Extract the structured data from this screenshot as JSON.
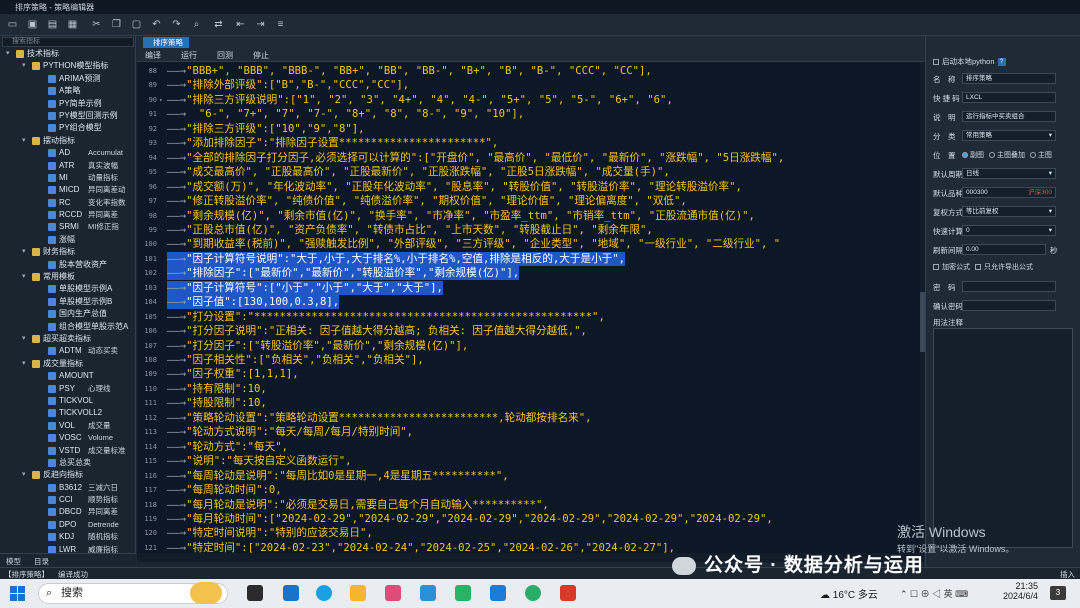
{
  "window": {
    "title": "排序策略 - 策略编辑器"
  },
  "toolbar": {
    "icons": [
      "new-file",
      "save",
      "save-as",
      "save-all",
      "cut",
      "copy",
      "paste",
      "undo",
      "redo",
      "find",
      "replace",
      "outdent",
      "indent",
      "comment"
    ]
  },
  "sidebar": {
    "search_placeholder": "搜索指标",
    "tree": [
      {
        "depth": 0,
        "kind": "folder",
        "label": "技术指标"
      },
      {
        "depth": 1,
        "kind": "folder",
        "label": "PYTHON模型指标"
      },
      {
        "depth": 2,
        "kind": "model",
        "label": "ARIMA预测"
      },
      {
        "depth": 2,
        "kind": "model",
        "label": "A策略"
      },
      {
        "depth": 2,
        "kind": "model",
        "label": "PY简单示例"
      },
      {
        "depth": 2,
        "kind": "model",
        "label": "PY模型回测示例"
      },
      {
        "depth": 2,
        "kind": "model",
        "label": "PY组合模型"
      },
      {
        "depth": 1,
        "kind": "folder",
        "label": "摆动指标"
      },
      {
        "depth": 2,
        "kind": "model",
        "label": "AD",
        "extra": "Accumulat"
      },
      {
        "depth": 2,
        "kind": "model",
        "label": "ATR",
        "extra": "真实波幅"
      },
      {
        "depth": 2,
        "kind": "model",
        "label": "MI",
        "extra": "动量指标"
      },
      {
        "depth": 2,
        "kind": "model",
        "label": "MICD",
        "extra": "异同离差动"
      },
      {
        "depth": 2,
        "kind": "model",
        "label": "RC",
        "extra": "变化率指数"
      },
      {
        "depth": 2,
        "kind": "model",
        "label": "RCCD",
        "extra": "异同离差"
      },
      {
        "depth": 2,
        "kind": "model",
        "label": "SRMI",
        "extra": "MI修正指"
      },
      {
        "depth": 2,
        "kind": "model",
        "label": "涨幅"
      },
      {
        "depth": 1,
        "kind": "folder",
        "label": "财务指标"
      },
      {
        "depth": 2,
        "kind": "model",
        "label": "股本营收资产"
      },
      {
        "depth": 1,
        "kind": "folder",
        "label": "常用模板"
      },
      {
        "depth": 2,
        "kind": "model",
        "label": "单股模型示例A"
      },
      {
        "depth": 2,
        "kind": "model",
        "label": "单股模型示例B"
      },
      {
        "depth": 2,
        "kind": "model",
        "label": "国内生产总值"
      },
      {
        "depth": 2,
        "kind": "model",
        "label": "组合模型单股示范A"
      },
      {
        "depth": 1,
        "kind": "folder",
        "label": "超买超卖指标"
      },
      {
        "depth": 2,
        "kind": "model",
        "label": "ADTM",
        "extra": "动态买卖"
      },
      {
        "depth": 1,
        "kind": "folder",
        "label": "成交量指标"
      },
      {
        "depth": 2,
        "kind": "model",
        "label": "AMOUNT"
      },
      {
        "depth": 2,
        "kind": "model",
        "label": "PSY",
        "extra": "心理线"
      },
      {
        "depth": 2,
        "kind": "model",
        "label": "TICKVOL"
      },
      {
        "depth": 2,
        "kind": "model",
        "label": "TICKVOLL2"
      },
      {
        "depth": 2,
        "kind": "model",
        "label": "VOL",
        "extra": "成交量"
      },
      {
        "depth": 2,
        "kind": "model",
        "label": "VOSC",
        "extra": "Volume"
      },
      {
        "depth": 2,
        "kind": "model",
        "label": "VSTD",
        "extra": "成交量标准"
      },
      {
        "depth": 2,
        "kind": "model",
        "label": "总买总卖"
      },
      {
        "depth": 1,
        "kind": "folder",
        "label": "反趋向指标"
      },
      {
        "depth": 2,
        "kind": "model",
        "label": "B3612",
        "extra": "三减六日"
      },
      {
        "depth": 2,
        "kind": "model",
        "label": "CCI",
        "extra": "顺势指标"
      },
      {
        "depth": 2,
        "kind": "model",
        "label": "DBCD",
        "extra": "异同离差"
      },
      {
        "depth": 2,
        "kind": "model",
        "label": "DPO",
        "extra": "Detrende"
      },
      {
        "depth": 2,
        "kind": "model",
        "label": "KDJ",
        "extra": "随机指标"
      },
      {
        "depth": 2,
        "kind": "model",
        "label": "LWR",
        "extra": "威廉指标"
      }
    ],
    "bottom_tabs": [
      "模型",
      "目录"
    ]
  },
  "editor": {
    "tab_label": "排序策略",
    "commands": [
      "编译",
      "运行",
      "回测",
      "停止"
    ],
    "lines": [
      {
        "n": 88,
        "code": "\"BBB+\", \"BBB\", \"BBB-\", \"BB+\", \"BB\", \"BB-\", \"B+\", \"B\", \"B-\", \"CCC\", \"CC\"],"
      },
      {
        "n": 89,
        "code": "\"排除外部评级\":[\"B\",\"B-\",\"CCC\",\"CC\"],"
      },
      {
        "n": 90,
        "code": "\"排除三方评级说明\":[\"1\", \"2\", \"3\", \"4+\", \"4\", \"4-\", \"5+\", \"5\", \"5-\", \"6+\", \"6\",",
        "fold": true
      },
      {
        "n": 91,
        "code": "  \"6-\", \"7+\", \"7\", \"7-\", \"8+\", \"8\", \"8-\", \"9\", \"10\"],"
      },
      {
        "n": 92,
        "code": "\"排除三方评级\":[\"10\",\"9\",\"8\"],"
      },
      {
        "n": 93,
        "code": "\"添加排除因子\":\"排除因子设置***********************\","
      },
      {
        "n": 94,
        "code": "\"全部的排除因子打分因子,必须选择可以计算的\":[\"开盘价\", \"最高价\", \"最低价\", \"最新价\", \"涨跌幅\", \"5日涨跌幅\","
      },
      {
        "n": 95,
        "code": "\"成交最高价\", \"正股最高价\", \"正股最新价\", \"正股涨跌幅\", \"正股5日涨跌幅\", \"成交量(手)\","
      },
      {
        "n": 96,
        "code": "\"成交额(万)\", \"年化波动率\", \"正股年化波动率\", \"股息率\", \"转股价值\", \"转股溢价率\", \"理论转股溢价率\","
      },
      {
        "n": 97,
        "code": "\"修正转股溢价率\", \"纯债价值\", \"纯债溢价率\", \"期权价值\", \"理论价值\", \"理论偏离度\", \"双低\","
      },
      {
        "n": 98,
        "code": "\"剩余规模(亿)\", \"剩余市值(亿)\", \"换手率\", \"市净率\", \"市盈率_ttm\", \"市销率_ttm\", \"正股流通市值(亿)\","
      },
      {
        "n": 99,
        "code": "\"正股总市值(亿)\", \"资产负债率\", \"转债市占比\", \"上市天数\", \"转股截止日\", \"剩余年限\","
      },
      {
        "n": 100,
        "code": "\"到期收益率(税前)\", \"强赎触发比例\", \"外部评级\", \"三方评级\", \"企业类型\", \"地域\", \"一级行业\", \"二级行业\", \""
      },
      {
        "n": 101,
        "code": "\"因子计算符号说明\":\"大于,小于,大于排名%,小于排名%,空值,排除是相反的,大于是小于\",",
        "sel": true
      },
      {
        "n": 102,
        "code": "\"排除因子\":[\"最新价\",\"最新价\",\"转股溢价率\",\"剩余规模(亿)\"],",
        "sel": true
      },
      {
        "n": 103,
        "code": "\"因子计算符号\":[\"小于\",\"小于\",\"大于\",\"大于\"],",
        "sel": true
      },
      {
        "n": 104,
        "code": "\"因子值\":[130,100,0.3,8],",
        "sel": true
      },
      {
        "n": 105,
        "code": "\"打分设置\":\"*****************************************************\","
      },
      {
        "n": 106,
        "code": "\"打分因子说明\":\"正相关: 因子值越大得分越高; 负相关: 因子值越大得分越低,\","
      },
      {
        "n": 107,
        "code": "\"打分因子\":[\"转股溢价率\",\"最新价\",\"剩余规模(亿)\"],"
      },
      {
        "n": 108,
        "code": "\"因子相关性\":[\"负相关\",\"负相关\",\"负相关\"],"
      },
      {
        "n": 109,
        "code": "\"因子权重\":[1,1,1],"
      },
      {
        "n": 110,
        "code": "\"持有限制\":10,"
      },
      {
        "n": 111,
        "code": "\"持股限制\":10,"
      },
      {
        "n": 112,
        "code": "\"策略轮动设置\":\"策略轮动设置*************************,轮动都按排名来\","
      },
      {
        "n": 113,
        "code": "\"轮动方式说明\":\"每天/每周/每月/特别时间\","
      },
      {
        "n": 114,
        "code": "\"轮动方式\":\"每天\","
      },
      {
        "n": 115,
        "code": "\"说明\":\"每天按自定义函数运行\","
      },
      {
        "n": 116,
        "code": "\"每周轮动是说明\":\"每周比如0是星期一,4是星期五**********\","
      },
      {
        "n": 117,
        "code": "\"每周轮动时间\":0,"
      },
      {
        "n": 118,
        "code": "\"每月轮动是说明\":\"必须是交易日,需要自己每个月自动输入**********\","
      },
      {
        "n": 119,
        "code": "\"每月轮动时间\":[\"2024-02-29\",\"2024-02-29\",\"2024-02-29\",\"2024-02-29\",\"2024-02-29\",\"2024-02-29\","
      },
      {
        "n": 120,
        "code": "\"特定时间说明\":\"特别的应该交易日\","
      },
      {
        "n": 121,
        "code": "\"特定时间\":[\"2024-02-23\",\"2024-02-24\",\"2024-02-25\",\"2024-02-26\",\"2024-02-27\"],"
      }
    ]
  },
  "properties": {
    "local_python_label": "启动本地python",
    "name_label": "名　称",
    "name_value": "排序策略",
    "shortcode_label": "快 捷 码",
    "shortcode_value": "LXCL",
    "desc_label": "说　明",
    "desc_value": "运行指标中买卖组合",
    "category_label": "分　类",
    "category_value": "常用策略",
    "position_label": "位　置",
    "position_options": [
      "副图",
      "主图叠加",
      "主图"
    ],
    "default_period_label": "默认周期",
    "default_period_value": "日线",
    "default_code_label": "默认品种",
    "default_code_value": "000300",
    "default_code_extra": "沪深300",
    "adjust_label": "复权方式",
    "adjust_value": "等比前复权",
    "fast_calc_label": "快速计算",
    "fast_calc_value": "0",
    "refresh_label": "刷新间隔",
    "refresh_value": "0.00",
    "refresh_unit": "秒",
    "encrypt_label": "加密公式",
    "buy_only_label": "只允许导出公式",
    "password_label": "密　码",
    "confirm_label": "确认密码",
    "notes_label": "用法注释"
  },
  "statusbar": {
    "tab": "【排序策略】",
    "message": "编译成功",
    "right": "插入"
  },
  "overlay": {
    "activate_title": "激活 Windows",
    "activate_sub": "转到\"设置\"以激活 Windows。",
    "watermark": "公众号 · 数据分析与运用"
  },
  "taskbar": {
    "search_label": "搜索",
    "weather_temp": "16°C",
    "weather_desc": "多云",
    "clock_time": "21:35",
    "clock_date": "2024/6/4",
    "notif_count": "3"
  }
}
